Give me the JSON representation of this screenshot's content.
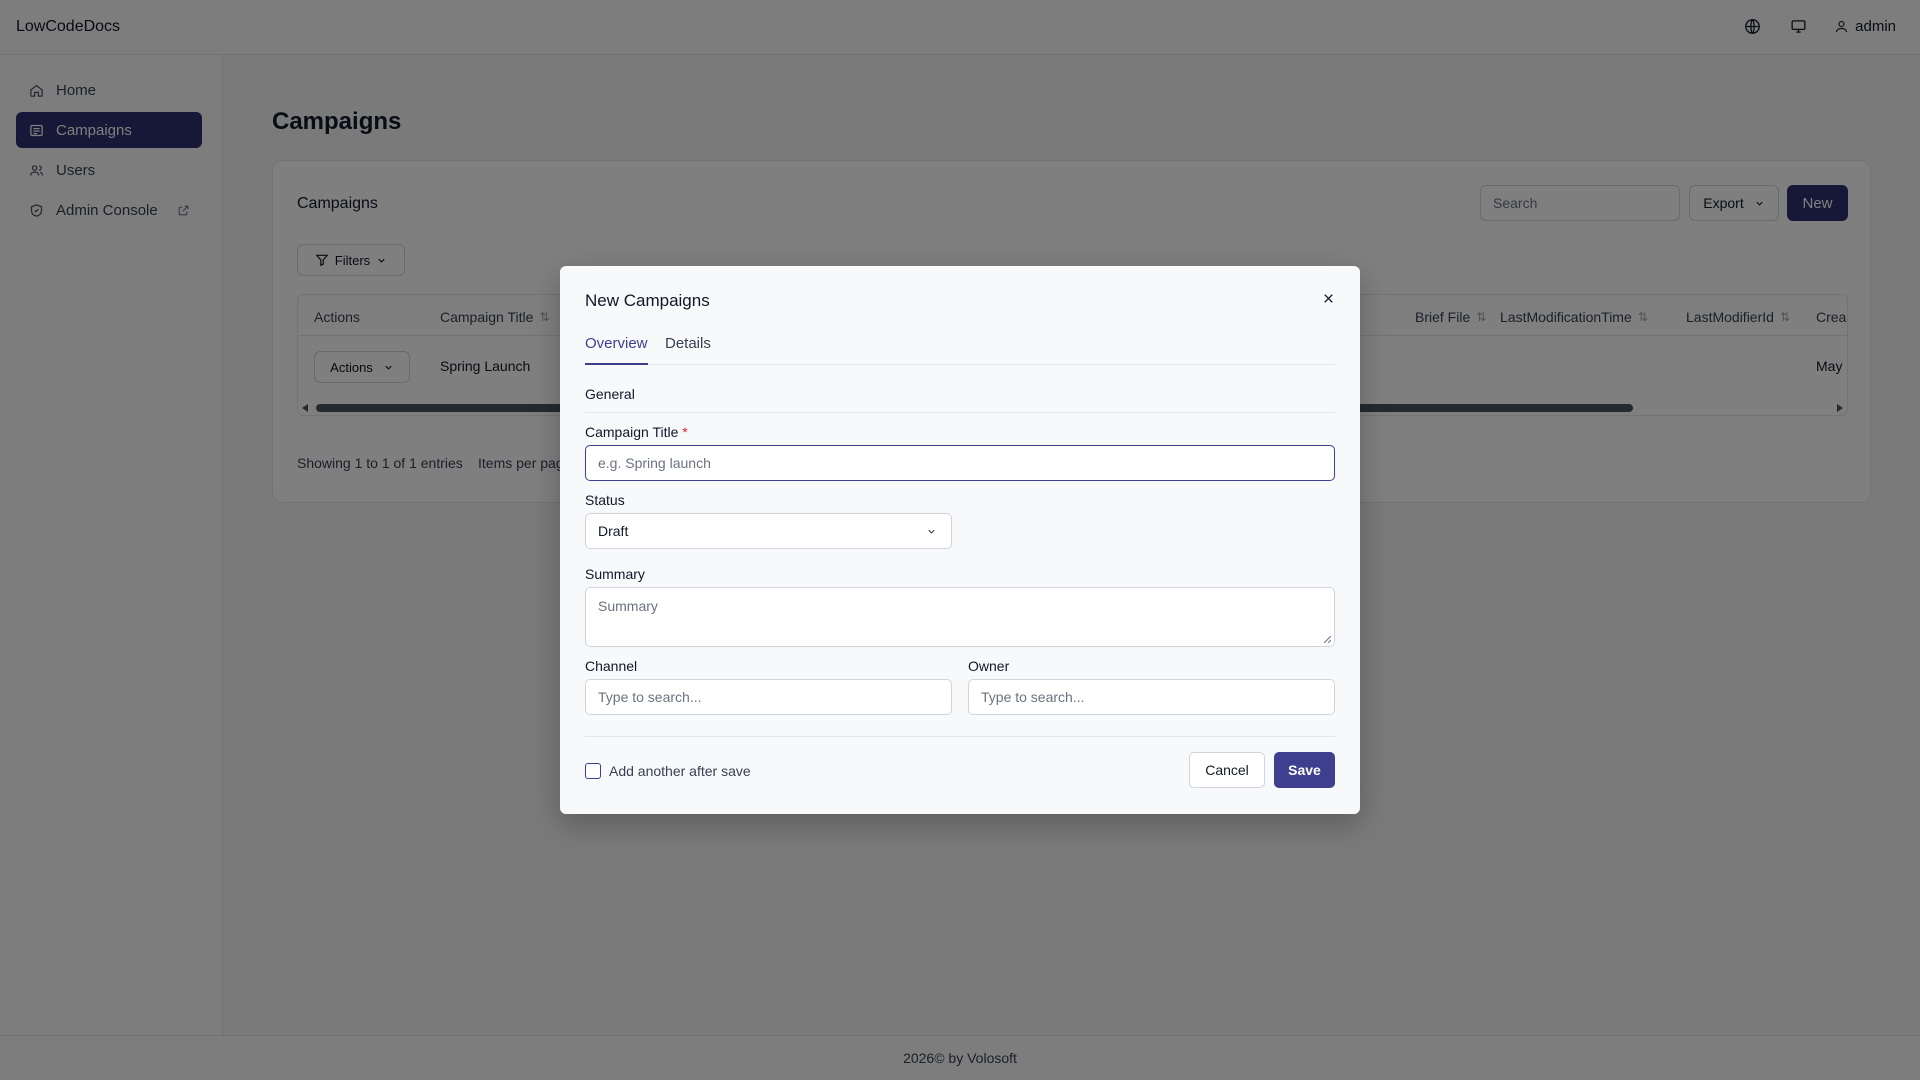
{
  "app": {
    "brand": "LowCodeDocs",
    "user": "admin",
    "footer": "2026© by Volosoft"
  },
  "sidebar": {
    "items": [
      {
        "label": "Home",
        "icon": "home-icon"
      },
      {
        "label": "Campaigns",
        "icon": "list-icon",
        "active": true
      },
      {
        "label": "Users",
        "icon": "users-icon"
      },
      {
        "label": "Admin Console",
        "icon": "shield-icon"
      }
    ]
  },
  "page": {
    "title": "Campaigns",
    "card_title": "Campaigns",
    "search_placeholder": "Search",
    "export_label": "Export",
    "new_label": "New",
    "filters_label": "Filters",
    "table": {
      "headers": [
        "Actions",
        "Campaign Title",
        "Brief File",
        "LastModificationTime",
        "LastModifierId",
        "Crea"
      ],
      "rows": [
        {
          "actions_label": "Actions",
          "campaign_title": "Spring Launch",
          "creation": "May"
        }
      ]
    },
    "showing": "Showing 1 to 1 of 1 entries",
    "items_per_page": "Items per pag"
  },
  "modal": {
    "title": "New Campaigns",
    "tabs": [
      "Overview",
      "Details"
    ],
    "section": "General",
    "campaign_title_label": "Campaign Title",
    "required_mark": "*",
    "campaign_title_placeholder": "e.g. Spring launch",
    "status_label": "Status",
    "status_value": "Draft",
    "summary_label": "Summary",
    "summary_placeholder": "Summary",
    "channel_label": "Channel",
    "channel_placeholder": "Type to search...",
    "owner_label": "Owner",
    "owner_placeholder": "Type to search...",
    "add_another_label": "Add another after save",
    "cancel_label": "Cancel",
    "save_label": "Save"
  },
  "colors": {
    "primary": "#2e2e6e",
    "accent": "#3f3f8f",
    "required": "#dc2626"
  }
}
